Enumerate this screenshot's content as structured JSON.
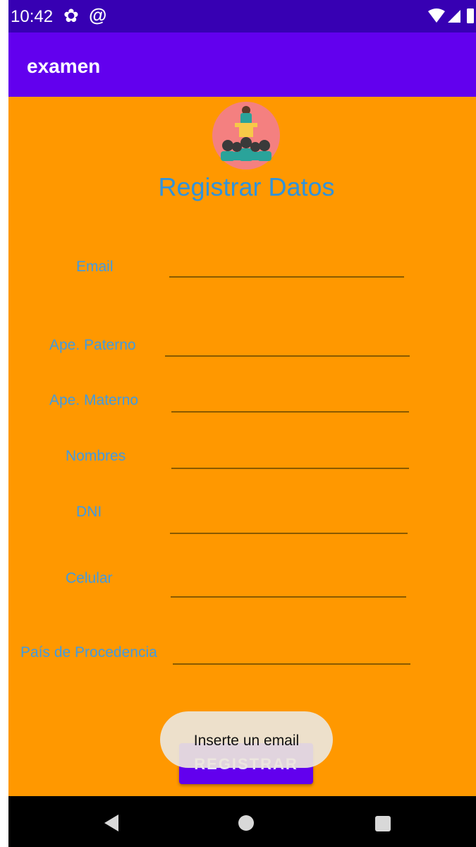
{
  "status_bar": {
    "time": "10:42",
    "icons": [
      "gear-icon",
      "at-icon",
      "wifi-icon",
      "signal-icon",
      "battery-icon"
    ]
  },
  "app_bar": {
    "title": "examen"
  },
  "form": {
    "title": "Registrar Datos",
    "fields": [
      {
        "label": "Email",
        "value": ""
      },
      {
        "label": "Ape. Paterno",
        "value": ""
      },
      {
        "label": "Ape. Materno",
        "value": ""
      },
      {
        "label": "Nombres",
        "value": ""
      },
      {
        "label": "DNI",
        "value": ""
      },
      {
        "label": "Celular",
        "value": ""
      },
      {
        "label": "País de Procedencia",
        "value": ""
      }
    ],
    "register_label": "REGISTRAR"
  },
  "toast": {
    "message": "Inserte un email"
  },
  "nav_bar": {
    "icons": [
      "back-icon",
      "home-icon",
      "recents-icon"
    ]
  },
  "colors": {
    "status_bar": "#3700b3",
    "app_bar": "#6200ee",
    "background": "#ff9800",
    "label_text": "#3f9be3",
    "button": "#6200ee"
  }
}
